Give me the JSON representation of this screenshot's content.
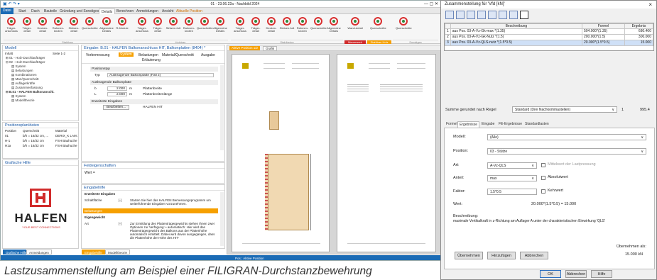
{
  "app": {
    "title": "01 - 23.06.22a - Nachbild 2024",
    "tabs": [
      "Datei",
      "Start",
      "Dach",
      "Bauteile",
      "Gründung und Sonstiges",
      "Details",
      "Berechnen",
      "Anmeldungen",
      "Ansicht",
      "Aktuelle Position"
    ],
    "ribbon_buttons": [
      "Träger-anschluss",
      "Träger-detail",
      "Decken-detail",
      "Rahmen-knoten",
      "Stützen-detail",
      "Querschnitte",
      "Allgemeine Details",
      "R-Module",
      "Träger-anschluss",
      "Träger-detail",
      "Stützen-fuß",
      "Rahmen-knoten",
      "Querschnitte",
      "Allgemeine Details",
      "Träger-anschluss",
      "Träger-detail",
      "Decken-detail",
      "Stützen-fuß",
      "Rahmen-knoten",
      "Querschnitte",
      "Allgemeine Details",
      "Wand-detail",
      "Querschnitte",
      "Querschnitte"
    ],
    "ribbon_groups": [
      "Stahlbau",
      "Holzbau",
      "Stahlbeton",
      "Mauerwerk",
      "Stahlbau Holz",
      "Sonstiges"
    ]
  },
  "model_panel": {
    "title": "Modell",
    "inhalt_label": "Inhalt",
    "seite_label": "Seite 1-2",
    "tree": [
      "01 - Holz-Durchlaufträger",
      "02 - Holz-Durchlaufträger",
      "System",
      "Belastungen",
      "Kombinationen",
      "Mat./Querschnitt",
      "Auflagerkräfte",
      "Zusammenfassung",
      "B.01 - HALFEN Balkonanschl.",
      "System",
      "Modelltheorie"
    ]
  },
  "positions_panel": {
    "title": "Positionsplan/daten",
    "columns": [
      "Position",
      "Querschnitt",
      "Material"
    ],
    "rows": [
      [
        "01",
        "b/h = 16/32 cm, ...",
        "DERIX_K LAM 1-10"
      ],
      [
        "H-1",
        "b/h = 16/32 cm",
        "FSH Bauhuche GL7"
      ],
      [
        "H1a",
        "b/h = 16/32 cm",
        "FSH Bauhuche GL7"
      ]
    ]
  },
  "help_panel": {
    "title": "Grafische Hilfe",
    "logo_text": "HALFEN",
    "tagline": "YOUR BEST CONNECTIONS"
  },
  "bottom_tabs": [
    "Grafische Hilfe",
    "Anmeldungen"
  ],
  "input_window": {
    "title": "Eingabe: B.01 - HALFEN Balkonanschluss HIT, Balkonplatten (8404) *",
    "tabs": [
      "Vorbemessung",
      "System",
      "Belastungen",
      "Material/Querschnitt",
      "Ausgabe",
      "Erläuterung"
    ],
    "section1": "Positionstyp",
    "typ_label": "Typ",
    "typ_value": "Auskragende Balkonplatte (Fall 2)",
    "section2": "Auskragende Balkonplatte",
    "b_label": "b",
    "b_value": "2.000",
    "b_unit": "m",
    "b_desc": "Plattenbreite",
    "l_label": "L",
    "l_value": "2.000",
    "l_unit": "m",
    "l_desc": "Plattenbreitenlänge",
    "section3": "Erweiterte Eingaben",
    "edit_button": "Bearbeiten...",
    "edit_value": "HALFEN HIT"
  },
  "feld_panel": {
    "title": "Feldeigenschaften",
    "wert_label": "Wert ="
  },
  "eingabehilfe": {
    "title": "Eingabehilfe",
    "heading": "Erweiterte Eingaben",
    "row1_label": "Schaltfläche",
    "row1_sym": "[-]",
    "row1_text": "Starten Sie hier das HALFEN Bemessungsprogramm um weiterführende Eingaben vorzunehmen.",
    "highlight": "Belastungen",
    "heading2": "Eigengewicht",
    "row2_label": "Art",
    "row2_sym": "[-]",
    "row2_text": "Zur Ermittlung des Plattenträgergewichts stehen Ihnen zwei Optionen zur Verfügung: • automatisch: Hier wird das Plattenträgergewicht des Balkons aus der Plattenhöhe automatisch ermittelt. Dabei wird davon ausgegangen, dass die Plattenhöhe der Höhe des HIT-",
    "tabs": [
      "Eingabehilfe",
      "Modelltheorie"
    ]
  },
  "doc_window": {
    "tab_active": "Aktive Position 1/2",
    "tab_other": "Grafik"
  },
  "statusbar_text": "Pos.: Aktive Position",
  "caption": "Lastzusammenstellung am Beispiel einer FILIGRAN-Durchstanzbewehrung",
  "dialog": {
    "title": "Zusammenstellung für 'Vfd [kN]'",
    "close": "×",
    "grid_columns": [
      "Beschreibung",
      "Formel",
      "Ergebnis"
    ],
    "grid_rows": [
      {
        "n": "1",
        "desc": "aus Pos. 03-A-Vz-Gk-max *(1.35)",
        "formel": "504.000*(1.35)",
        "ergebnis": "680.400"
      },
      {
        "n": "2",
        "desc": "aus Pos. 03-A-Vz-Gk-Nutz *(1.5)",
        "formel": "200.000*(1.5)",
        "ergebnis": "300.000"
      },
      {
        "n": "3",
        "desc": "aus Pos. 03-A-Vz-QLS-nutz *(1.5*0.5)",
        "formel": "20.000*(1.5*0.5)",
        "ergebnis": "15.000"
      }
    ],
    "summe_label": "Summe gerundet nach Regel",
    "summe_select": "Standard (Drei Nachkommastellen)",
    "summe_unit": "1",
    "summe_value": "995.4",
    "tabs": [
      "Formel",
      "Ergebnisse",
      "Eingabe",
      "FE-Ergebnisse",
      "Standardlasten"
    ],
    "modell_label": "Modell:",
    "modell_value": "(Alle)",
    "position_label": "Position:",
    "position_value": "03 - Stütze",
    "art_label": "Art:",
    "art_value": "A-Vz-QLS",
    "mittelwert_label": "Mittelwert der Lastpressung",
    "anteil_label": "Anteil:",
    "anteil_value": "max",
    "absolutwert_label": "Absolutwert",
    "faktor_label": "Faktor:",
    "faktor_value": "1.5*0.5",
    "kehrwert_label": "Kehrwert",
    "wert_label": "Wert:",
    "wert_value": "20.000*(1.5*0.5) = 15.000",
    "beschreibung_label": "Beschreibung:",
    "beschreibung_text": "maximale Vertikalkraft in z-Richtung am Auflager A unter der charakteristischen Einwirkung 'QLS'",
    "btn_uebernehmen": "Übernehmen",
    "btn_hinzufuegen": "Hinzufügen",
    "btn_abbrechen": "Abbrechen",
    "uebernehmen_als_label": "Übernehmen als:",
    "uebernehmen_als_value": "15.000 kN",
    "btn_ok": "OK",
    "btn_cancel": "Abbrechen",
    "btn_help": "Hilfe"
  }
}
